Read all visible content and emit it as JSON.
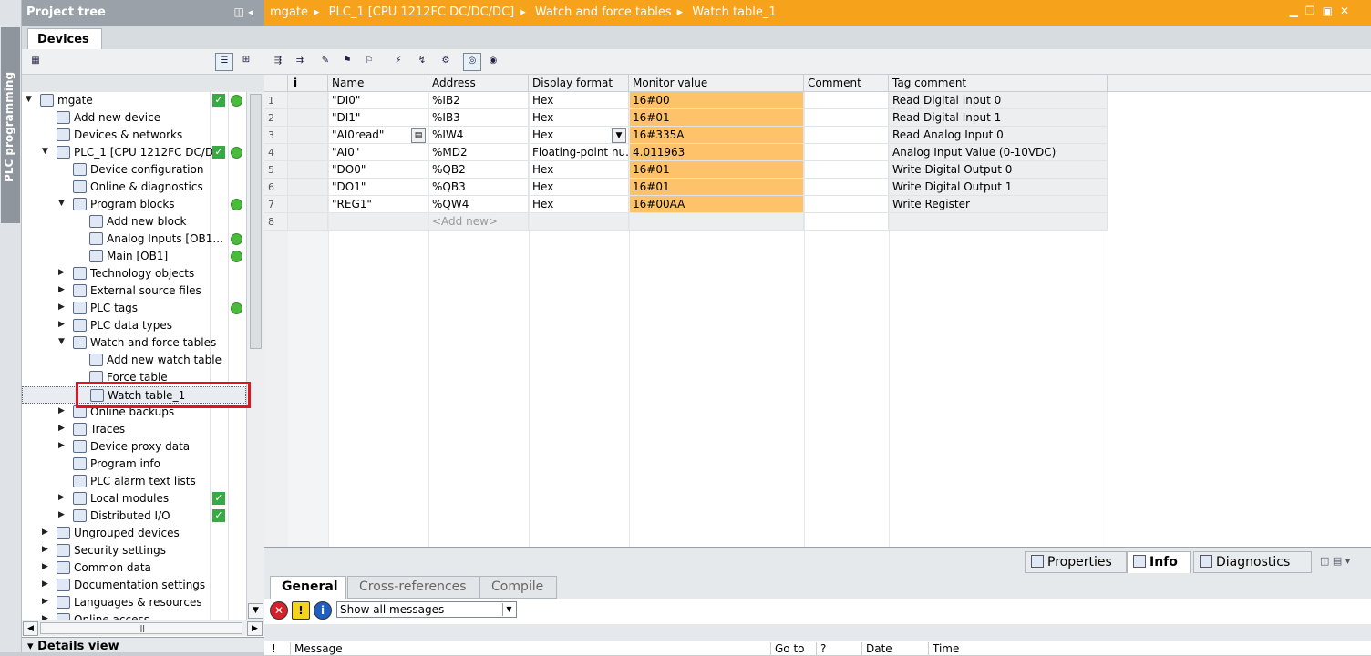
{
  "side_tab": {
    "label": "PLC programming"
  },
  "project_tree": {
    "title": "Project tree",
    "tab": "Devices",
    "details_label": "Details view",
    "items": [
      {
        "label": "mgate",
        "check": true,
        "dot": true
      },
      {
        "label": "Add new device"
      },
      {
        "label": "Devices & networks"
      },
      {
        "label": "PLC_1 [CPU 1212FC DC/D...",
        "check": true,
        "dot": true
      },
      {
        "label": "Device configuration"
      },
      {
        "label": "Online & diagnostics"
      },
      {
        "label": "Program blocks",
        "dot": true
      },
      {
        "label": "Add new block"
      },
      {
        "label": "Analog Inputs [OB1...",
        "dot": true
      },
      {
        "label": "Main [OB1]",
        "dot": true
      },
      {
        "label": "Technology objects"
      },
      {
        "label": "External source files"
      },
      {
        "label": "PLC tags",
        "dot": true
      },
      {
        "label": "PLC data types"
      },
      {
        "label": "Watch and force tables"
      },
      {
        "label": "Add new watch table"
      },
      {
        "label": "Force table"
      },
      {
        "label": "Watch table_1"
      },
      {
        "label": "Online backups"
      },
      {
        "label": "Traces"
      },
      {
        "label": "Device proxy data"
      },
      {
        "label": "Program info"
      },
      {
        "label": "PLC alarm text lists"
      },
      {
        "label": "Local modules",
        "check": true
      },
      {
        "label": "Distributed I/O",
        "check": true
      },
      {
        "label": "Ungrouped devices"
      },
      {
        "label": "Security settings"
      },
      {
        "label": "Common data"
      },
      {
        "label": "Documentation settings"
      },
      {
        "label": "Languages & resources"
      },
      {
        "label": "Online access"
      }
    ]
  },
  "editor": {
    "breadcrumb": [
      "mgate",
      "PLC_1 [CPU 1212FC DC/DC/DC]",
      "Watch and force tables",
      "Watch table_1"
    ],
    "columns": {
      "info": "i",
      "name": "Name",
      "address": "Address",
      "format": "Display format",
      "monitor": "Monitor value",
      "comment": "Comment",
      "tagcomment": "Tag comment"
    },
    "rows": [
      {
        "n": "1",
        "name": "\"DI0\"",
        "address": "%IB2",
        "format": "Hex",
        "monitor": "16#00",
        "tagcomment": "Read Digital Input 0"
      },
      {
        "n": "2",
        "name": "\"DI1\"",
        "address": "%IB3",
        "format": "Hex",
        "monitor": "16#01",
        "tagcomment": "Read Digital Input 1"
      },
      {
        "n": "3",
        "name": "\"AI0read\"",
        "address": "%IW4",
        "format": "Hex",
        "monitor": "16#335A",
        "tagcomment": "Read Analog Input 0"
      },
      {
        "n": "4",
        "name": "\"AI0\"",
        "address": "%MD2",
        "format": "Floating-point nu...",
        "monitor": "4.011963",
        "tagcomment": "Analog Input Value (0-10VDC)"
      },
      {
        "n": "5",
        "name": "\"DO0\"",
        "address": "%QB2",
        "format": "Hex",
        "monitor": "16#01",
        "tagcomment": "Write Digital Output 0"
      },
      {
        "n": "6",
        "name": "\"DO1\"",
        "address": "%QB3",
        "format": "Hex",
        "monitor": "16#01",
        "tagcomment": "Write Digital Output 1"
      },
      {
        "n": "7",
        "name": "\"REG1\"",
        "address": "%QW4",
        "format": "Hex",
        "monitor": "16#00AA",
        "tagcomment": "Write Register"
      }
    ],
    "new_row": {
      "n": "8",
      "address": "<Add new>"
    }
  },
  "inspector": {
    "tabs": [
      "Properties",
      "Info",
      "Diagnostics"
    ],
    "subtabs": [
      "General",
      "Cross-references",
      "Compile"
    ],
    "filter": "Show all messages",
    "columns": [
      "!",
      "Message",
      "Go to",
      "?",
      "Date",
      "Time"
    ]
  },
  "colors": {
    "title_orange": "#f7a21b",
    "monitor_bg": "#fdc26a",
    "highlight_red": "#e0141e"
  }
}
